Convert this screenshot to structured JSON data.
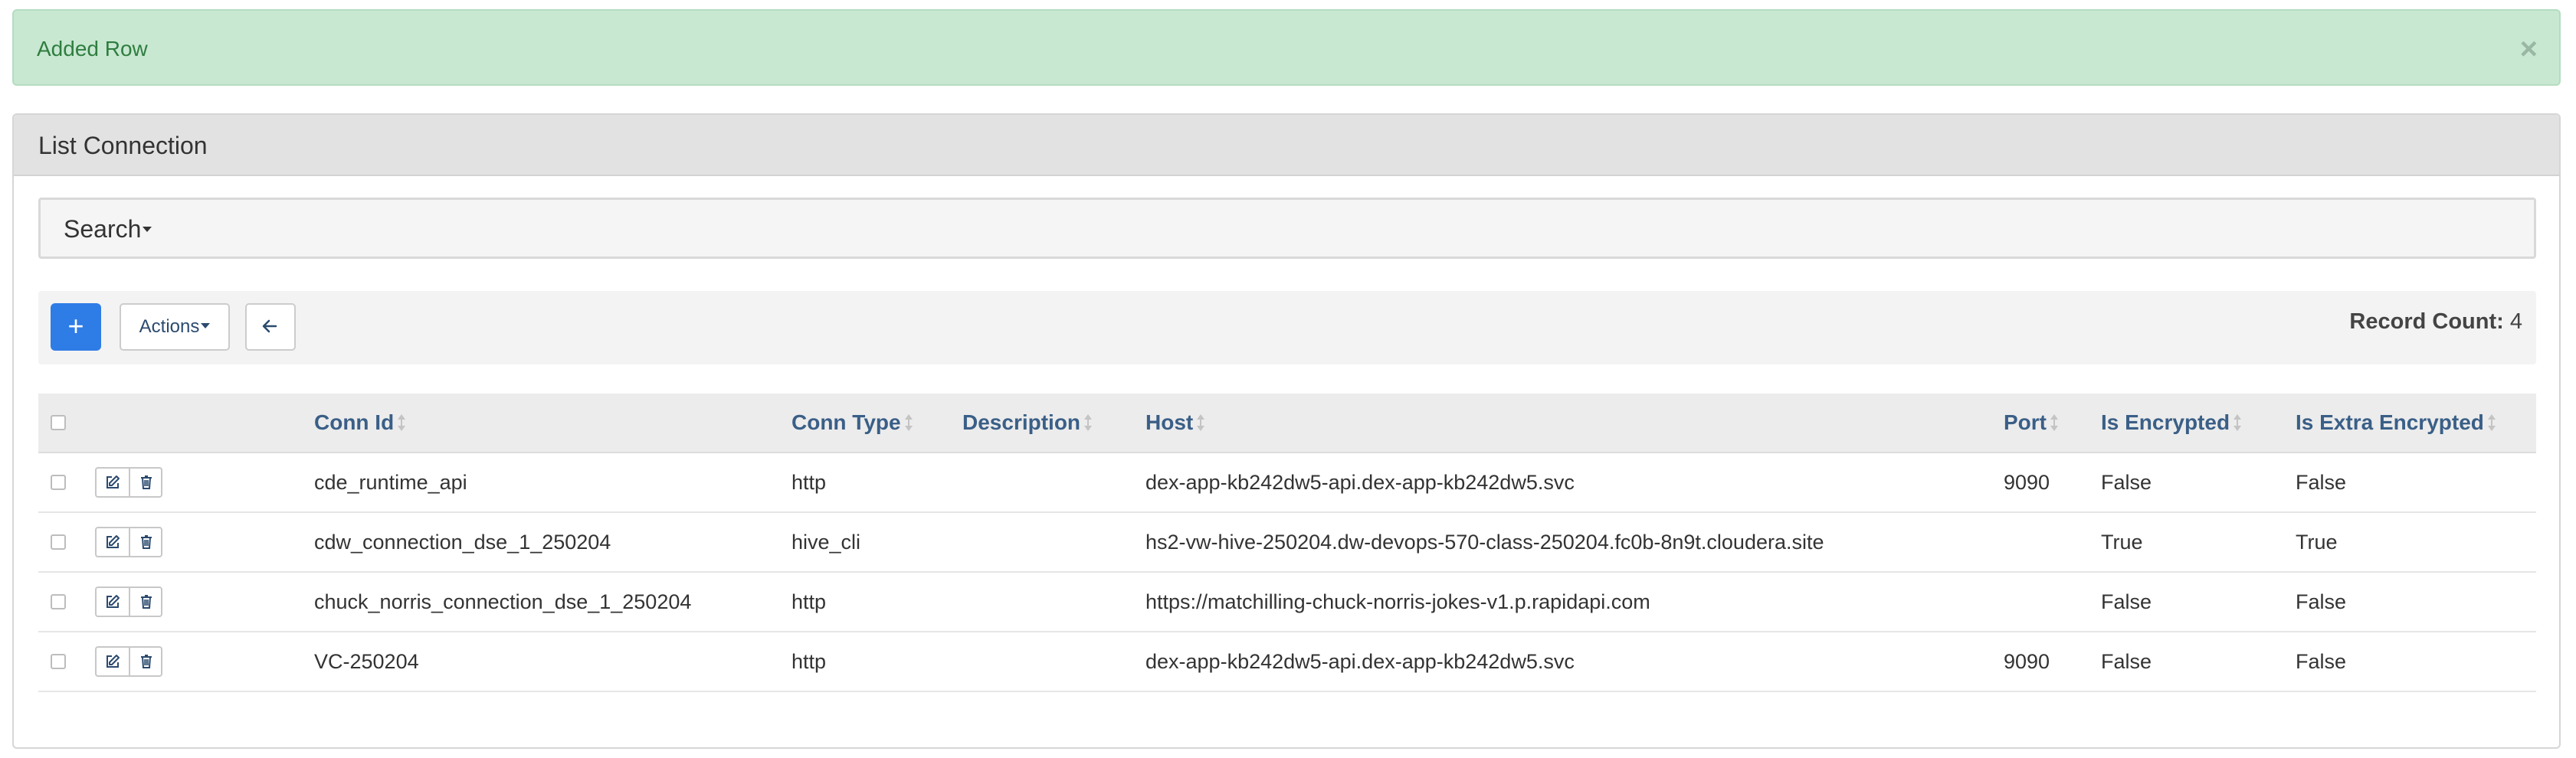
{
  "alert": {
    "message": "Added Row",
    "close_glyph": "×"
  },
  "panel": {
    "title": "List Connection"
  },
  "search": {
    "label": "Search"
  },
  "toolbar": {
    "add_glyph": "+",
    "actions_label": "Actions",
    "back_icon": "arrow-left-icon",
    "record_count_label": "Record Count:",
    "record_count_value": "4"
  },
  "table": {
    "columns": {
      "conn_id": "Conn Id",
      "conn_type": "Conn Type",
      "description": "Description",
      "host": "Host",
      "port": "Port",
      "is_encrypted": "Is Encrypted",
      "is_extra_encrypted": "Is Extra Encrypted"
    },
    "rows": [
      {
        "conn_id": "cde_runtime_api",
        "conn_type": "http",
        "description": "",
        "host": "dex-app-kb242dw5-api.dex-app-kb242dw5.svc",
        "port": "9090",
        "is_encrypted": "False",
        "is_extra_encrypted": "False"
      },
      {
        "conn_id": "cdw_connection_dse_1_250204",
        "conn_type": "hive_cli",
        "description": "",
        "host": "hs2-vw-hive-250204.dw-devops-570-class-250204.fc0b-8n9t.cloudera.site",
        "port": "",
        "is_encrypted": "True",
        "is_extra_encrypted": "True"
      },
      {
        "conn_id": "chuck_norris_connection_dse_1_250204",
        "conn_type": "http",
        "description": "",
        "host": "https://matchilling-chuck-norris-jokes-v1.p.rapidapi.com",
        "port": "",
        "is_encrypted": "False",
        "is_extra_encrypted": "False"
      },
      {
        "conn_id": "VC-250204",
        "conn_type": "http",
        "description": "",
        "host": "dex-app-kb242dw5-api.dex-app-kb242dw5.svc",
        "port": "9090",
        "is_encrypted": "False",
        "is_extra_encrypted": "False"
      }
    ]
  },
  "colors": {
    "alert_bg": "#c8e8d2",
    "alert_text": "#2f7d3f",
    "primary": "#2e7ce6",
    "header_link": "#3a5f87"
  }
}
